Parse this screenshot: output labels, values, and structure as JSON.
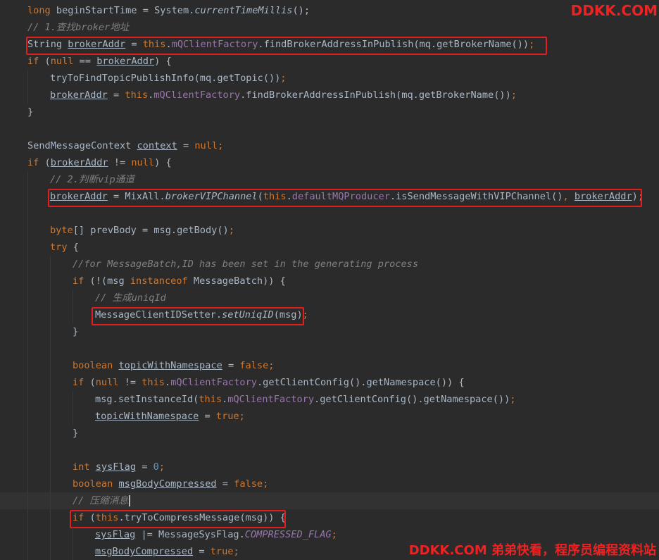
{
  "watermarks": {
    "top": "DDKK.COM",
    "bottom": "DDKK.COM 弟弟快看，程序员编程资料站"
  },
  "colors": {
    "background": "#2b2b2b",
    "keyword": "#cc7832",
    "comment": "#808080",
    "field": "#9876aa",
    "number": "#6897bb",
    "text": "#a9b7c6",
    "highlight_box": "#e02020"
  },
  "lines": [
    {
      "indent": 1,
      "tokens": [
        [
          "kw",
          "long"
        ],
        [
          "p",
          " beginStartTime = System."
        ],
        [
          "stat",
          "currentTimeMillis"
        ],
        [
          "p",
          "();"
        ]
      ]
    },
    {
      "indent": 1,
      "tokens": [
        [
          "cmt",
          "// 1.查找broker地址"
        ]
      ]
    },
    {
      "indent": 1,
      "tokens": [
        [
          "p",
          "String "
        ],
        [
          "ul",
          "brokerAddr"
        ],
        [
          "p",
          " = "
        ],
        [
          "kw",
          "this"
        ],
        [
          "p",
          "."
        ],
        [
          "fld",
          "mQClientFactory"
        ],
        [
          "p",
          ".findBrokerAddressInPublish(mq.getBrokerName())"
        ],
        [
          "kw",
          ";"
        ]
      ]
    },
    {
      "indent": 1,
      "tokens": [
        [
          "kw",
          "if"
        ],
        [
          "p",
          " ("
        ],
        [
          "kw",
          "null"
        ],
        [
          "p",
          " == "
        ],
        [
          "ul",
          "brokerAddr"
        ],
        [
          "p",
          ") {"
        ]
      ]
    },
    {
      "indent": 2,
      "tokens": [
        [
          "p",
          "tryToFindTopicPublishInfo(mq.getTopic())"
        ],
        [
          "kw",
          ";"
        ]
      ]
    },
    {
      "indent": 2,
      "tokens": [
        [
          "ul",
          "brokerAddr"
        ],
        [
          "p",
          " = "
        ],
        [
          "kw",
          "this"
        ],
        [
          "p",
          "."
        ],
        [
          "fld",
          "mQClientFactory"
        ],
        [
          "p",
          ".findBrokerAddressInPublish(mq.getBrokerName())"
        ],
        [
          "kw",
          ";"
        ]
      ]
    },
    {
      "indent": 1,
      "tokens": [
        [
          "p",
          "}"
        ]
      ]
    },
    {
      "indent": 1,
      "tokens": []
    },
    {
      "indent": 1,
      "tokens": [
        [
          "p",
          "SendMessageContext "
        ],
        [
          "ul",
          "context"
        ],
        [
          "p",
          " = "
        ],
        [
          "kw",
          "null;"
        ]
      ]
    },
    {
      "indent": 1,
      "tokens": [
        [
          "kw",
          "if"
        ],
        [
          "p",
          " ("
        ],
        [
          "ul",
          "brokerAddr"
        ],
        [
          "p",
          " != "
        ],
        [
          "kw",
          "null"
        ],
        [
          "p",
          ") {"
        ]
      ]
    },
    {
      "indent": 2,
      "tokens": [
        [
          "cmt",
          "// 2.判断vip通道"
        ]
      ]
    },
    {
      "indent": 2,
      "tokens": [
        [
          "ul",
          "brokerAddr"
        ],
        [
          "p",
          " = MixAll."
        ],
        [
          "stat",
          "brokerVIPChannel"
        ],
        [
          "p",
          "("
        ],
        [
          "kw",
          "this"
        ],
        [
          "p",
          "."
        ],
        [
          "fld",
          "defaultMQProducer"
        ],
        [
          "p",
          ".isSendMessageWithVIPChannel()"
        ],
        [
          "kw",
          ", "
        ],
        [
          "ul",
          "brokerAddr"
        ],
        [
          "p",
          ")"
        ],
        [
          "kw",
          ";"
        ]
      ]
    },
    {
      "indent": 2,
      "tokens": []
    },
    {
      "indent": 2,
      "tokens": [
        [
          "kw",
          "byte"
        ],
        [
          "p",
          "[] prevBody = msg.getBody()"
        ],
        [
          "kw",
          ";"
        ]
      ]
    },
    {
      "indent": 2,
      "tokens": [
        [
          "kw",
          "try"
        ],
        [
          "p",
          " {"
        ]
      ]
    },
    {
      "indent": 3,
      "tokens": [
        [
          "cmt",
          "//for MessageBatch,ID has been set in the generating process"
        ]
      ]
    },
    {
      "indent": 3,
      "tokens": [
        [
          "kw",
          "if"
        ],
        [
          "p",
          " (!(msg "
        ],
        [
          "kw",
          "instanceof"
        ],
        [
          "p",
          " MessageBatch)) {"
        ]
      ]
    },
    {
      "indent": 4,
      "tokens": [
        [
          "cmt",
          "// 生成uniqId"
        ]
      ]
    },
    {
      "indent": 4,
      "tokens": [
        [
          "p",
          "MessageClientIDSetter."
        ],
        [
          "stat",
          "setUniqID"
        ],
        [
          "p",
          "(msg)"
        ],
        [
          "kw",
          ";"
        ]
      ]
    },
    {
      "indent": 3,
      "tokens": [
        [
          "p",
          "}"
        ]
      ]
    },
    {
      "indent": 3,
      "tokens": []
    },
    {
      "indent": 3,
      "tokens": [
        [
          "kw",
          "boolean "
        ],
        [
          "ul",
          "topicWithNamespace"
        ],
        [
          "p",
          " = "
        ],
        [
          "kw",
          "false;"
        ]
      ]
    },
    {
      "indent": 3,
      "tokens": [
        [
          "kw",
          "if"
        ],
        [
          "p",
          " ("
        ],
        [
          "kw",
          "null"
        ],
        [
          "p",
          " != "
        ],
        [
          "kw",
          "this"
        ],
        [
          "p",
          "."
        ],
        [
          "fld",
          "mQClientFactory"
        ],
        [
          "p",
          ".getClientConfig().getNamespace()) {"
        ]
      ]
    },
    {
      "indent": 4,
      "tokens": [
        [
          "p",
          "msg.setInstanceId("
        ],
        [
          "kw",
          "this"
        ],
        [
          "p",
          "."
        ],
        [
          "fld",
          "mQClientFactory"
        ],
        [
          "p",
          ".getClientConfig().getNamespace())"
        ],
        [
          "kw",
          ";"
        ]
      ]
    },
    {
      "indent": 4,
      "tokens": [
        [
          "ul",
          "topicWithNamespace"
        ],
        [
          "p",
          " = "
        ],
        [
          "kw",
          "true;"
        ]
      ]
    },
    {
      "indent": 3,
      "tokens": [
        [
          "p",
          "}"
        ]
      ]
    },
    {
      "indent": 3,
      "tokens": []
    },
    {
      "indent": 3,
      "tokens": [
        [
          "kw",
          "int "
        ],
        [
          "ul",
          "sysFlag"
        ],
        [
          "p",
          " = "
        ],
        [
          "num",
          "0"
        ],
        [
          "kw",
          ";"
        ]
      ]
    },
    {
      "indent": 3,
      "tokens": [
        [
          "kw",
          "boolean "
        ],
        [
          "ul",
          "msgBodyCompressed"
        ],
        [
          "p",
          " = "
        ],
        [
          "kw",
          "false;"
        ]
      ]
    },
    {
      "indent": 3,
      "caret": true,
      "tokens": [
        [
          "cmt",
          "// 压缩消息"
        ]
      ]
    },
    {
      "indent": 3,
      "tokens": [
        [
          "kw",
          "if"
        ],
        [
          "p",
          " ("
        ],
        [
          "kw",
          "this"
        ],
        [
          "p",
          ".tryToCompressMessage(msg)) {"
        ]
      ]
    },
    {
      "indent": 4,
      "tokens": [
        [
          "ul",
          "sysFlag"
        ],
        [
          "p",
          " |= MessageSysFlag."
        ],
        [
          "cst",
          "COMPRESSED_FLAG"
        ],
        [
          "kw",
          ";"
        ]
      ]
    },
    {
      "indent": 4,
      "tokens": [
        [
          "ul",
          "msgBodyCompressed"
        ],
        [
          "p",
          " = "
        ],
        [
          "kw",
          "true;"
        ]
      ]
    }
  ]
}
